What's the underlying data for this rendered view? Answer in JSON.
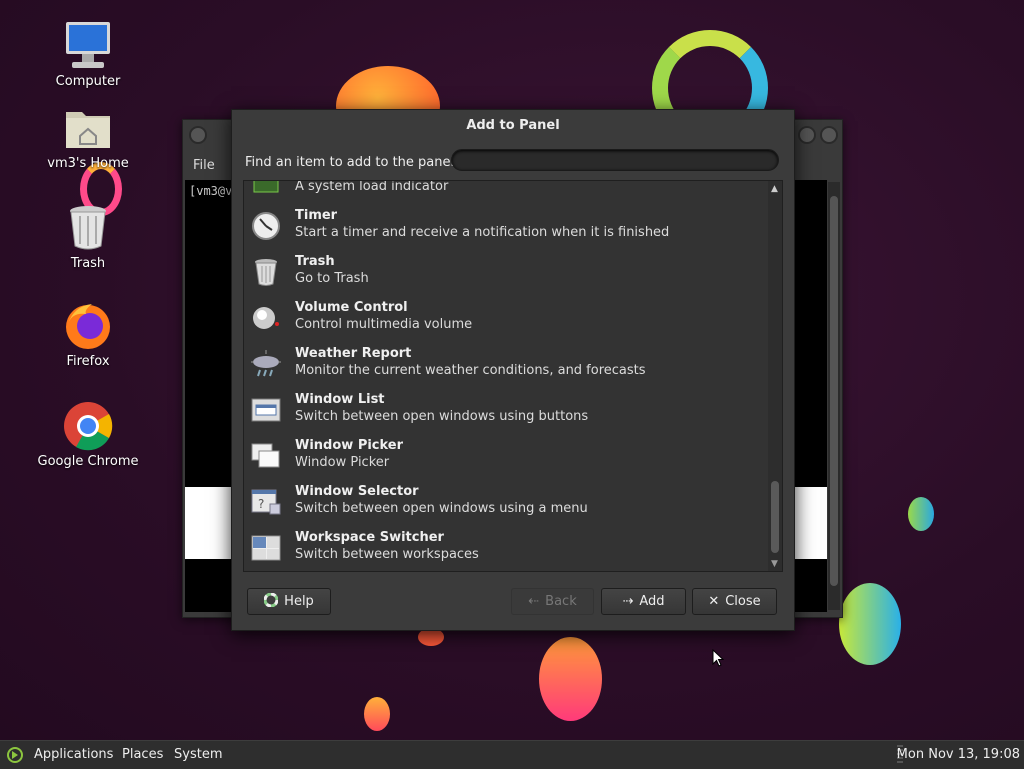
{
  "desktop": {
    "icons": [
      {
        "label": "Computer",
        "icon": "computer-icon"
      },
      {
        "label": "vm3's Home",
        "icon": "home-folder-icon"
      },
      {
        "label": "Trash",
        "icon": "trash-icon"
      },
      {
        "label": "Firefox",
        "icon": "firefox-icon"
      },
      {
        "label": "Google Chrome",
        "icon": "chrome-icon"
      }
    ]
  },
  "terminal": {
    "menu_file": "File",
    "prompt": "[vm3@v"
  },
  "dialog": {
    "title": "Add to Panel",
    "find_label": "Find an item to add to the panel:",
    "search_value": "",
    "items": [
      {
        "name": "",
        "desc": "A system load indicator",
        "icon": "system-monitor-icon"
      },
      {
        "name": "Timer",
        "desc": "Start a timer and receive a notification when it is finished",
        "icon": "timer-icon"
      },
      {
        "name": "Trash",
        "desc": "Go to Trash",
        "icon": "trash-icon"
      },
      {
        "name": "Volume Control",
        "desc": "Control multimedia volume",
        "icon": "volume-icon"
      },
      {
        "name": "Weather Report",
        "desc": "Monitor the current weather conditions, and forecasts",
        "icon": "weather-icon"
      },
      {
        "name": "Window List",
        "desc": "Switch between open windows using buttons",
        "icon": "window-list-icon"
      },
      {
        "name": "Window Picker",
        "desc": "Window Picker",
        "icon": "window-picker-icon"
      },
      {
        "name": "Window Selector",
        "desc": "Switch between open windows using a menu",
        "icon": "window-selector-icon"
      },
      {
        "name": "Workspace Switcher",
        "desc": "Switch between workspaces",
        "icon": "workspace-switcher-icon"
      }
    ],
    "buttons": {
      "help": "Help",
      "back": "Back",
      "add": "Add",
      "close": "Close"
    }
  },
  "panel": {
    "menus": [
      "Applications",
      "Places",
      "System"
    ],
    "clock": "Mon Nov 13, 19:08"
  }
}
